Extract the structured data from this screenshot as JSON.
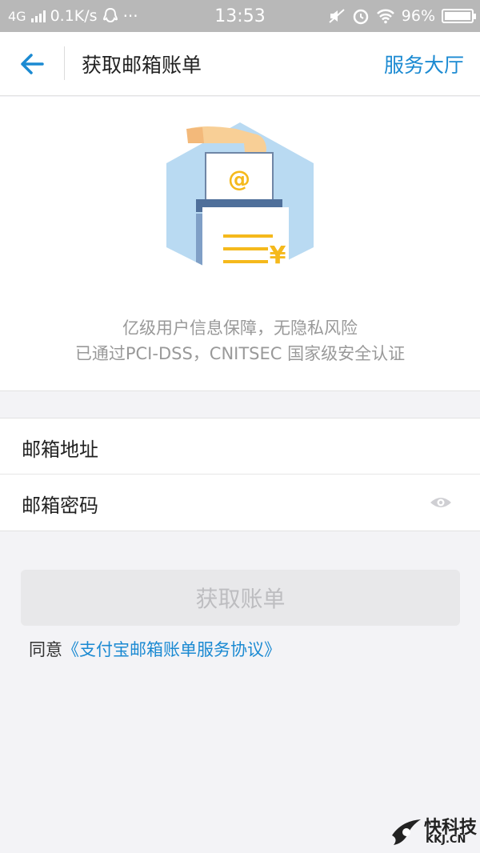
{
  "status_bar": {
    "network": "4G",
    "speed": "0.1K/s",
    "more": "···",
    "time": "13:53",
    "battery": "96%"
  },
  "header": {
    "title": "获取邮箱账单",
    "right_action": "服务大厅"
  },
  "hero": {
    "illustration_icons": [
      "hand-icon",
      "envelope-at-icon",
      "bill-yuan-icon"
    ],
    "line1": "亿级用户信息保障，无隐私风险",
    "line2": "已通过PCI-DSS，CNITSEC 国家级安全认证",
    "colors": {
      "hexagon": "#b9daf2",
      "hexagon_dark": "#7f9fc6",
      "accent_yellow": "#f5b91c"
    }
  },
  "form": {
    "email_label": "邮箱地址",
    "email_value": "",
    "password_label": "邮箱密码",
    "password_value": ""
  },
  "submit": {
    "label": "获取账单"
  },
  "agreement": {
    "prefix": "同意",
    "link": "《支付宝邮箱账单服务协议》"
  },
  "watermark": {
    "brand": "快科技",
    "domain": "KKJ.CN"
  },
  "colors": {
    "accent": "#1b8ad2",
    "background": "#f3f3f6",
    "disabled_button": "#e8e8ea"
  }
}
